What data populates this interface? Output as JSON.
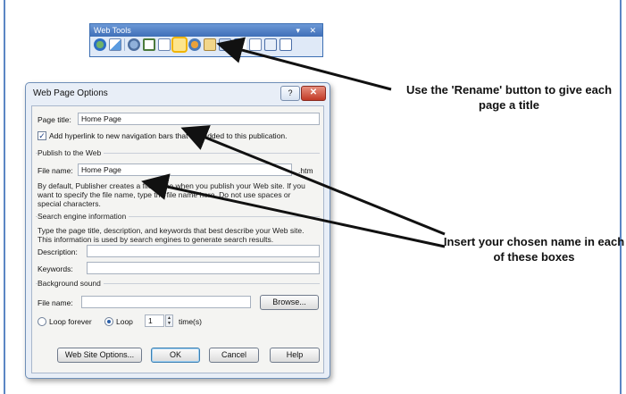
{
  "toolbar": {
    "title": "Web Tools",
    "controls": "▾ ✕",
    "icons": [
      "globe-icon",
      "preview-icon",
      "sep",
      "hyperlink-icon",
      "form-icon",
      "page-icon",
      "rename-icon",
      "hotspot-icon",
      "bookmark-icon",
      "web-button-icon",
      "design-icon",
      "insert-icon",
      "html-icon",
      "properties-icon"
    ]
  },
  "dialog": {
    "title": "Web Page Options",
    "help_label": "?",
    "close_label": "✕",
    "page_title_label": "Page title:",
    "page_title_value": "Home Page",
    "hyperlink_checkbox_label": "Add hyperlink to new navigation bars that are added to this publication.",
    "publish_section": "Publish to the Web",
    "file_name_label": "File name:",
    "file_name_value": "Home Page",
    "file_ext": ".htm",
    "publish_help": "By default, Publisher creates a file name when you publish your Web site. If you want to specify the file name, type the file name here. Do not use spaces or special characters.",
    "search_section": "Search engine information",
    "search_help": "Type the page title, description, and keywords that best describe your Web site. This information is used by search engines to generate search results.",
    "description_label": "Description:",
    "keywords_label": "Keywords:",
    "sound_section": "Background sound",
    "sound_file_label": "File name:",
    "browse_label": "Browse...",
    "loop_forever_label": "Loop forever",
    "loop_label": "Loop",
    "loop_count": "1",
    "times_label": "time(s)",
    "buttons": {
      "web_site_options": "Web Site Options...",
      "ok": "OK",
      "cancel": "Cancel",
      "help": "Help"
    }
  },
  "annotations": {
    "rename_note": "Use the 'Rename' button to give each page a title",
    "insert_note": "Insert your chosen name in each of these boxes"
  }
}
